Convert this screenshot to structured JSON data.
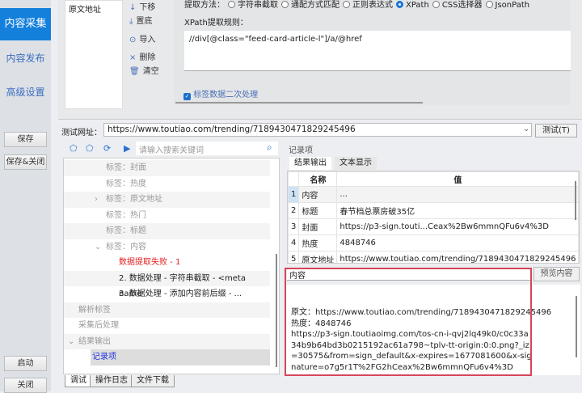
{
  "sidebar": {
    "items": [
      {
        "label": "内容采集",
        "selected": true
      },
      {
        "label": "内容发布"
      },
      {
        "label": "高级设置"
      }
    ],
    "save": "保存",
    "save_close": "保存&关闭",
    "start": "启动",
    "close": "关闭"
  },
  "tags": {
    "items": [
      "原文地址"
    ]
  },
  "tools": {
    "down": "下移",
    "bottom": "置底",
    "import": "导入",
    "delete": "删除",
    "clear": "清空"
  },
  "rules": {
    "method_label": "提取方法：",
    "methods": [
      "字符串截取",
      "通配方式匹配",
      "正则表达式",
      "XPath",
      "CSS选择器",
      "JsonPath"
    ],
    "selected_method": "XPath",
    "xpath_label": "XPath提取规则：",
    "xpath_value": "//div[@class=\"feed-card-article-l\"]/a/@href",
    "secondary_label": "标签数据二次处理",
    "secondary_checked": true
  },
  "url": {
    "label": "测试网址：",
    "value": "https://www.toutiao.com/trending/7189430471829245496",
    "test_button": "测试(T)"
  },
  "tree": {
    "search_placeholder": "请输入搜索关键词",
    "rows": [
      {
        "label": "标签：封面"
      },
      {
        "label": "标签：热度"
      },
      {
        "label": "标签：原文地址",
        "arrow": "›"
      },
      {
        "label": "标签：热门"
      },
      {
        "label": "标签：标题"
      },
      {
        "label": "标签：内容",
        "arrow": "⌄"
      },
      {
        "label": "数据提取失败 - 1"
      },
      {
        "label": "2. 数据处理 - 字符串截取 - <meta name"
      },
      {
        "label": "3. 数据处理 - 添加内容前后缀 - ..."
      },
      {
        "label": "解析标签"
      },
      {
        "label": "采集后处理"
      },
      {
        "label": "结果输出",
        "arrow": "⌄"
      },
      {
        "label": "记录项"
      }
    ]
  },
  "bottom_tabs": [
    "调试",
    "操作日志",
    "文件下载"
  ],
  "records": {
    "title": "记录项",
    "tabs": [
      "结果输出",
      "文本显示"
    ],
    "columns": [
      "名称",
      "值"
    ],
    "rows": [
      {
        "n": "1",
        "name": "内容",
        "value": "..."
      },
      {
        "n": "2",
        "name": "标题",
        "value": "春节档总票房破35亿"
      },
      {
        "n": "3",
        "name": "封面",
        "value": "https://p3-sign.touti...Ceax%2Bw6mmnQFu6v4%3D"
      },
      {
        "n": "4",
        "name": "热度",
        "value": "4848746"
      },
      {
        "n": "5",
        "name": "原文地址",
        "value": "https://www.toutiao.com/trending/7189430471829245496"
      }
    ],
    "field": "内容",
    "preview_button": "预览内容",
    "preview_lines": [
      "原文：https://www.toutiao.com/trending/7189430471829245496",
      "热度：4848746",
      "https://p3-sign.toutiaoimg.com/tos-cn-i-qvj2lq49k0/c0c33a34b9b64bd3b0215192ac61a798~tplv-tt-origin:0:0.png?_iz=30575&from=sign_default&x-expires=1677081600&x-signature=o7g5r1T%2FG2hCeax%2Bw6mmnQFu6v4%3D"
    ]
  },
  "colors": {
    "accent": "#1480dc",
    "error": "#e02020",
    "highlight": "#d6455a"
  }
}
